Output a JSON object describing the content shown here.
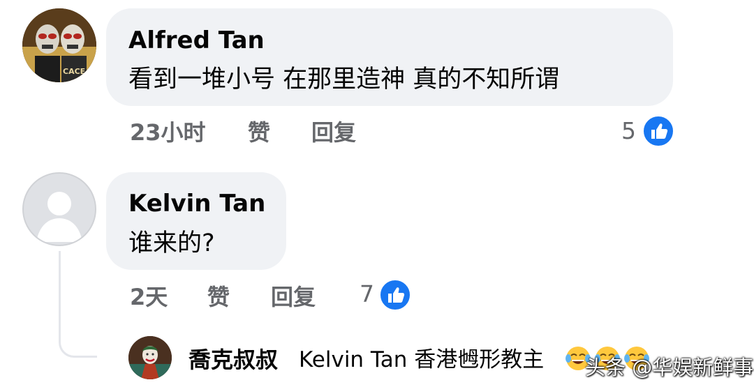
{
  "comments": [
    {
      "author": "Alfred Tan",
      "text": "看到一堆小号 在那里造神 真的不知所谓",
      "time": "23小时",
      "like_label": "赞",
      "reply_label": "回复",
      "reaction_count": "5",
      "avatar_caption": "CACE"
    },
    {
      "author": "Kelvin Tan",
      "text": "谁来的?",
      "time": "2天",
      "like_label": "赞",
      "reply_label": "回复",
      "reaction_count": "7"
    }
  ],
  "reply": {
    "author": "喬克叔叔",
    "text": "Kelvin Tan 香港乸形教主"
  },
  "reaction_icon": "thumbs-up-icon",
  "watermark": "头条 @华娱新鲜事",
  "colors": {
    "bubble": "#f0f2f5",
    "meta_text": "#65676b",
    "like_blue": "#1877f2"
  }
}
